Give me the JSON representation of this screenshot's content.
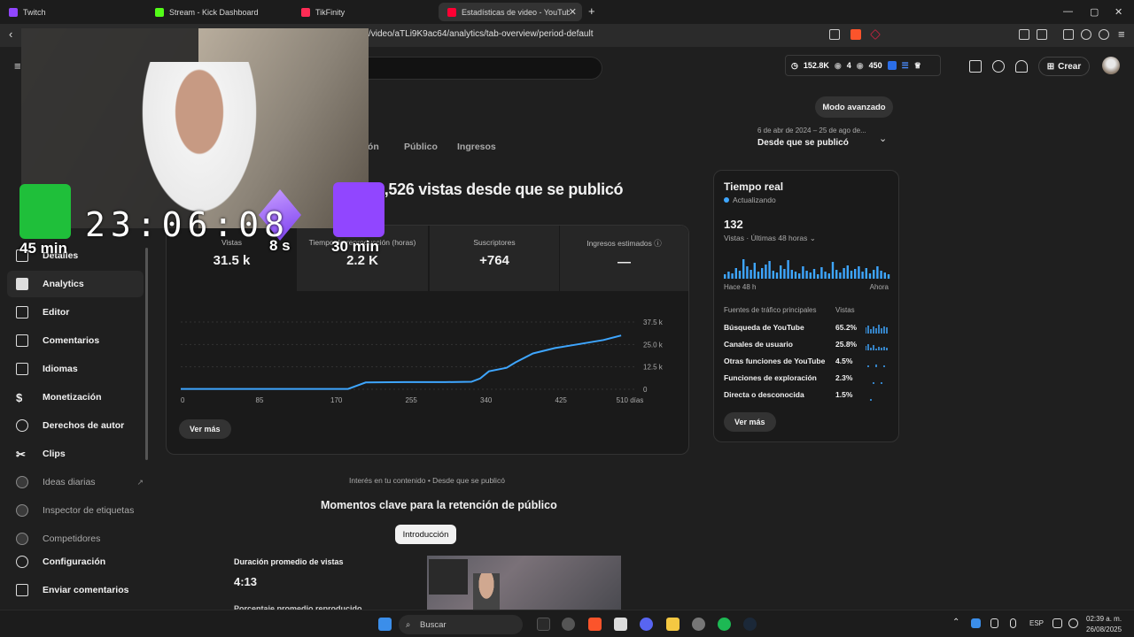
{
  "browser": {
    "tabs": [
      {
        "label": "Twitch",
        "favicon_color": "#9146ff"
      },
      {
        "label": "Stream - Kick Dashboard",
        "favicon_color": "#53fc18"
      },
      {
        "label": "TikFinity",
        "favicon_color": "#fe2c55"
      },
      {
        "label": "Estadísticas de video - YouTube",
        "favicon_color": "#ff0033"
      }
    ],
    "url": "/video/aTLi9K9ac64/analytics/tab-overview/period-default"
  },
  "header": {
    "stat_views": "152.8K",
    "stat_eye1": "4",
    "stat_eye2": "450",
    "create_label": "Crear"
  },
  "sidebar": {
    "items": [
      {
        "label": "Detalles",
        "icon": "pencil-icon"
      },
      {
        "label": "Analytics",
        "icon": "analytics-icon"
      },
      {
        "label": "Editor",
        "icon": "editor-icon"
      },
      {
        "label": "Comentarios",
        "icon": "comments-icon"
      },
      {
        "label": "Idiomas",
        "icon": "languages-icon"
      },
      {
        "label": "Monetización",
        "icon": "dollar-icon"
      },
      {
        "label": "Derechos de autor",
        "icon": "copyright-icon"
      },
      {
        "label": "Clips",
        "icon": "scissors-icon"
      },
      {
        "label": "Ideas diarias",
        "icon": "ext-icon"
      },
      {
        "label": "Inspector de etiquetas",
        "icon": "ext-icon"
      },
      {
        "label": "Competidores",
        "icon": "ext-icon"
      },
      {
        "label": "Configuración",
        "icon": "gear-icon"
      },
      {
        "label": "Enviar comentarios",
        "icon": "feedback-icon"
      }
    ]
  },
  "main": {
    "tabs": [
      "ión",
      "Público",
      "Ingresos"
    ],
    "advanced_mode": "Modo avanzado",
    "period_range": "6 de abr de 2024 – 25 de ago de...",
    "period_selected": "Desde que se publicó",
    "headline": "1,526 vistas desde que se publicó",
    "metrics": [
      {
        "label": "Vistas",
        "value": "31.5 k"
      },
      {
        "label": "Tiempo de reproducción (horas)",
        "value": "2.2 K"
      },
      {
        "label": "Suscriptores",
        "value": "+764"
      },
      {
        "label": "Ingresos estimados",
        "value": "—"
      }
    ],
    "see_more": "Ver más"
  },
  "chart_data": {
    "type": "line",
    "x_ticks": [
      "0",
      "85",
      "170",
      "255",
      "340",
      "425",
      "510 días"
    ],
    "y_ticks": [
      "37.5 k",
      "25.0 k",
      "12.5 k",
      "0"
    ],
    "ylim": [
      0,
      37500
    ],
    "xlim": [
      0,
      510
    ],
    "x": [
      0,
      85,
      170,
      190,
      200,
      210,
      255,
      300,
      330,
      340,
      350,
      370,
      380,
      400,
      425,
      450,
      480,
      500
    ],
    "y": [
      200,
      200,
      200,
      200,
      2000,
      3800,
      4000,
      4000,
      4200,
      6000,
      10000,
      12000,
      15000,
      20000,
      23000,
      25000,
      27500,
      30000
    ],
    "color": "#3ea6ff"
  },
  "realtime": {
    "title": "Tiempo real",
    "status": "Actualizando",
    "count": "132",
    "subtitle": "Vistas · Últimas 48 horas",
    "left_label": "Hace 48 h",
    "right_label": "Ahora",
    "col_source": "Fuentes de tráfico principales",
    "col_views": "Vistas",
    "sources": [
      {
        "name": "Búsqueda de YouTube",
        "pct": "65.2%"
      },
      {
        "name": "Canales de usuario",
        "pct": "25.8%"
      },
      {
        "name": "Otras funciones de YouTube",
        "pct": "4.5%"
      },
      {
        "name": "Funciones de exploración",
        "pct": "2.3%"
      },
      {
        "name": "Directa o desconocida",
        "pct": "1.5%"
      }
    ],
    "see_more": "Ver más"
  },
  "retention": {
    "interest": "Interés en tu contenido • Desde que se publicó",
    "title": "Momentos clave para la retención de público",
    "chip": "Introducción",
    "avg_duration_label": "Duración promedio de vistas",
    "avg_duration_value": "4:13",
    "avg_pct_label": "Porcentaje promedio reproducido"
  },
  "overlay": {
    "timer": "23:06:08",
    "gift1": "45 min",
    "gift2": "8 s",
    "gift3": "30 min"
  },
  "taskbar": {
    "search": "Buscar",
    "lang": "ESP",
    "time": "02:39 a. m.",
    "date": "26/08/2025"
  }
}
